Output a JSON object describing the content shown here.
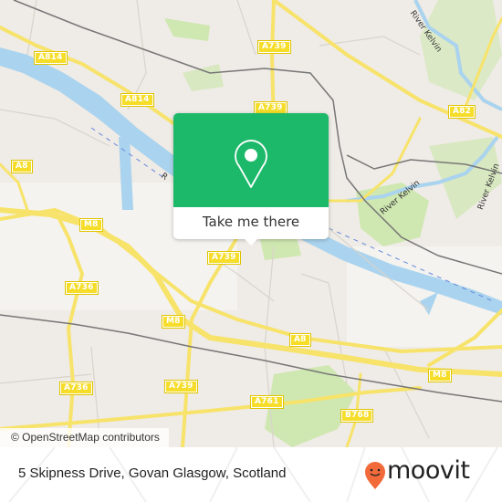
{
  "map": {
    "road_labels": [
      {
        "label": "A814",
        "ref": "a814-west"
      },
      {
        "label": "A814",
        "ref": "a814-east"
      },
      {
        "label": "A739",
        "ref": "a739-north"
      },
      {
        "label": "A739",
        "ref": "a739-mid"
      },
      {
        "label": "A82",
        "ref": "a82"
      },
      {
        "label": "A8",
        "ref": "a8-west"
      },
      {
        "label": "M8",
        "ref": "m8-west"
      },
      {
        "label": "A739",
        "ref": "a739-south-popup"
      },
      {
        "label": "A736",
        "ref": "a736-north"
      },
      {
        "label": "M8",
        "ref": "m8-mid"
      },
      {
        "label": "A8",
        "ref": "a8-east"
      },
      {
        "label": "M8",
        "ref": "m8-east"
      },
      {
        "label": "A736",
        "ref": "a736-south"
      },
      {
        "label": "A739",
        "ref": "a739-south"
      },
      {
        "label": "A761",
        "ref": "a761"
      },
      {
        "label": "B768",
        "ref": "b768"
      }
    ],
    "water_labels": [
      "River Kelvin",
      "River Kelvin",
      "River Kelvin",
      "R"
    ],
    "colors": {
      "land": "#efebe6",
      "water": "#a9d3ee",
      "park": "#cfe7b0",
      "road_major": "#f7e36a",
      "rail": "#777777"
    }
  },
  "attribution": "© OpenStreetMap contributors",
  "popup": {
    "icon": "location-pin-icon",
    "button_label": "Take me there",
    "accent": "#1db96a"
  },
  "footer": {
    "address": "5 Skipness Drive, Govan Glasgow, Scotland",
    "brand": "moovit",
    "brand_color": "#f26a3a"
  }
}
